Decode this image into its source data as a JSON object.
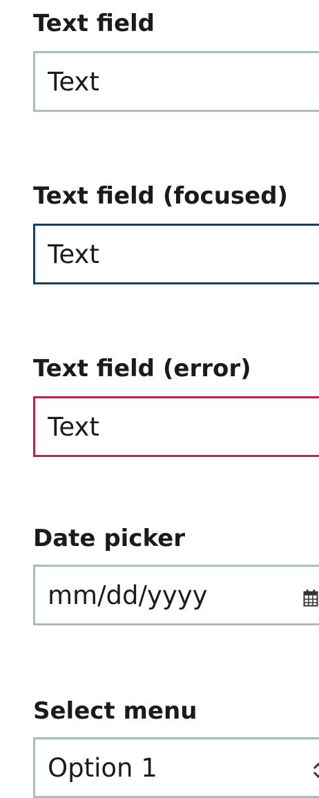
{
  "fields": {
    "text": {
      "label": "Text field",
      "value": "Text"
    },
    "focused": {
      "label": "Text field (focused)",
      "value": "Text"
    },
    "error": {
      "label": "Text field (error)",
      "value": "Text"
    },
    "date": {
      "label": "Date picker",
      "placeholder": "mm/dd/yyyy",
      "icon": "calendar-icon"
    },
    "select": {
      "label": "Select menu",
      "value": "Option 1",
      "icon": "chevron-updown-icon"
    }
  },
  "colors": {
    "border_default": "#a7bbc1",
    "border_focused": "#16405e",
    "border_error": "#b22a4a",
    "text": "#1b1b1b"
  }
}
